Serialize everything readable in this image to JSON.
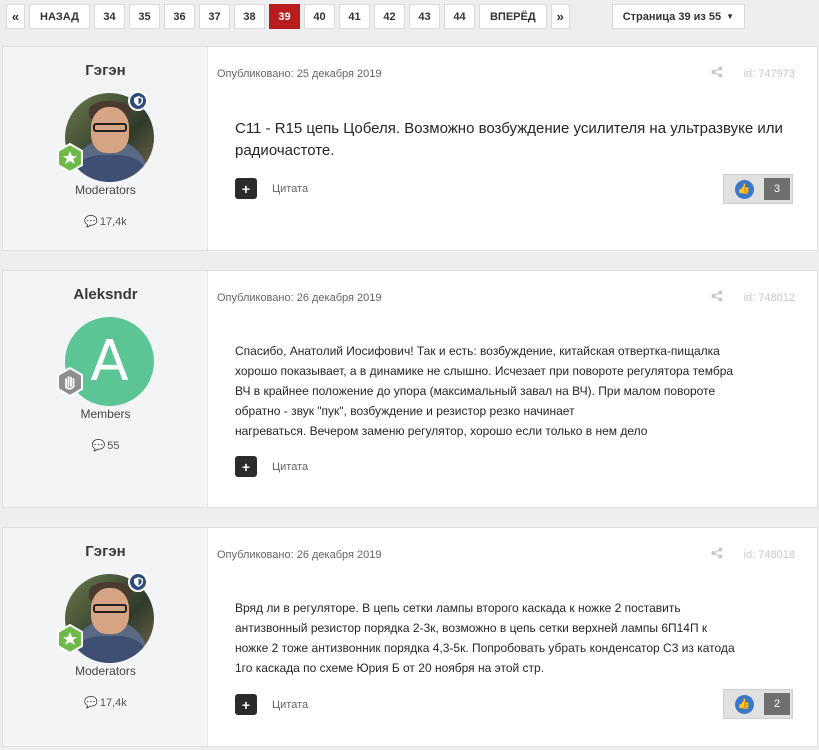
{
  "pagination": {
    "prev_icon": "«",
    "back": "НАЗАД",
    "pages": [
      "34",
      "35",
      "36",
      "37",
      "38",
      "39",
      "40",
      "41",
      "42",
      "43",
      "44"
    ],
    "active": "39",
    "next": "ВПЕРЁД",
    "next_icon": "»",
    "page_jump": "Страница 39 из 55",
    "accent": "#b91c1c"
  },
  "posts": [
    {
      "author": "Гэгэн",
      "role": "Moderators",
      "post_count": "17,4k",
      "date": "Опубликовано: 25 декабря 2019",
      "id": "id: 747973",
      "text": "C11 - R15  цепь Цобеля.  Возможно возбуждение усилителя на ультразвуке или радиочастоте.",
      "quote": "Цитата",
      "reactions": "3"
    },
    {
      "author": "Aleksndr",
      "avatar_letter": "A",
      "role": "Members",
      "post_count": "55",
      "date": "Опубликовано: 26 декабря 2019",
      "id": "id: 748012",
      "text_lines": [
        "Спасибо, Анатолий Иосифович! Так и есть: возбуждение, китайская отвертка-пищалка",
        "хорошо показывает, а в динамике не слышно. Исчезает при повороте регулятора тембра",
        "ВЧ в крайнее положение до упора (максимальный завал на ВЧ).   При малом повороте",
        "обратно - звук \"пук\", возбуждение и резистор резко начинает",
        "нагреваться. Вечером заменю регулятор, хорошо если только в нем дело"
      ],
      "quote": "Цитата"
    },
    {
      "author": "Гэгэн",
      "role": "Moderators",
      "post_count": "17,4k",
      "date": "Опубликовано: 26 декабря 2019",
      "id": "id: 748018",
      "text_lines": [
        "Вряд ли в регуляторе. В цепь сетки лампы второго каскада к ножке 2 поставить",
        "антизвонный резистор порядка 2-3к, возможно в цепь сетки верхней лампы 6П14П к",
        "ножке 2 тоже антизвонник порядка 4,3-5к. Попробовать убрать конденсатор С3 из катода",
        "1го  каскада по схеме Юрия Б от 20 ноября на этой стр."
      ],
      "quote": "Цитата",
      "reactions": "2"
    }
  ],
  "icons": {
    "share": "share-icon",
    "comment": "speech-bubble-icon",
    "like": "thumbs-up-icon",
    "quote": "plus-icon",
    "moderator": "shield-icon",
    "rank_star": "star-icon",
    "rank_hand": "hand-icon"
  }
}
